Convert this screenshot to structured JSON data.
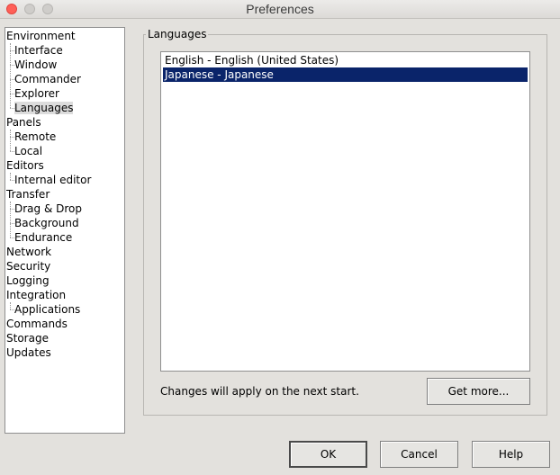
{
  "window": {
    "title": "Preferences"
  },
  "tree": {
    "items": [
      {
        "label": "Environment",
        "level": 0
      },
      {
        "label": "Interface",
        "level": 1
      },
      {
        "label": "Window",
        "level": 1
      },
      {
        "label": "Commander",
        "level": 1
      },
      {
        "label": "Explorer",
        "level": 1
      },
      {
        "label": "Languages",
        "level": 1,
        "selected": true
      },
      {
        "label": "Panels",
        "level": 0
      },
      {
        "label": "Remote",
        "level": 1
      },
      {
        "label": "Local",
        "level": 1
      },
      {
        "label": "Editors",
        "level": 0
      },
      {
        "label": "Internal editor",
        "level": 1
      },
      {
        "label": "Transfer",
        "level": 0
      },
      {
        "label": "Drag & Drop",
        "level": 1
      },
      {
        "label": "Background",
        "level": 1
      },
      {
        "label": "Endurance",
        "level": 1
      },
      {
        "label": "Network",
        "level": 0
      },
      {
        "label": "Security",
        "level": 0
      },
      {
        "label": "Logging",
        "level": 0
      },
      {
        "label": "Integration",
        "level": 0
      },
      {
        "label": "Applications",
        "level": 1
      },
      {
        "label": "Commands",
        "level": 0
      },
      {
        "label": "Storage",
        "level": 0
      },
      {
        "label": "Updates",
        "level": 0
      }
    ]
  },
  "languages": {
    "group_title": "Languages",
    "items": [
      {
        "label": "English - English (United States)",
        "selected": false
      },
      {
        "label": "Japanese - Japanese",
        "selected": true
      }
    ],
    "note": "Changes will apply on the next start.",
    "get_more_label": "Get more..."
  },
  "buttons": {
    "ok": "OK",
    "cancel": "Cancel",
    "help": "Help"
  },
  "colors": {
    "selection": "#0a246a",
    "close_button": "#ff5f57"
  }
}
